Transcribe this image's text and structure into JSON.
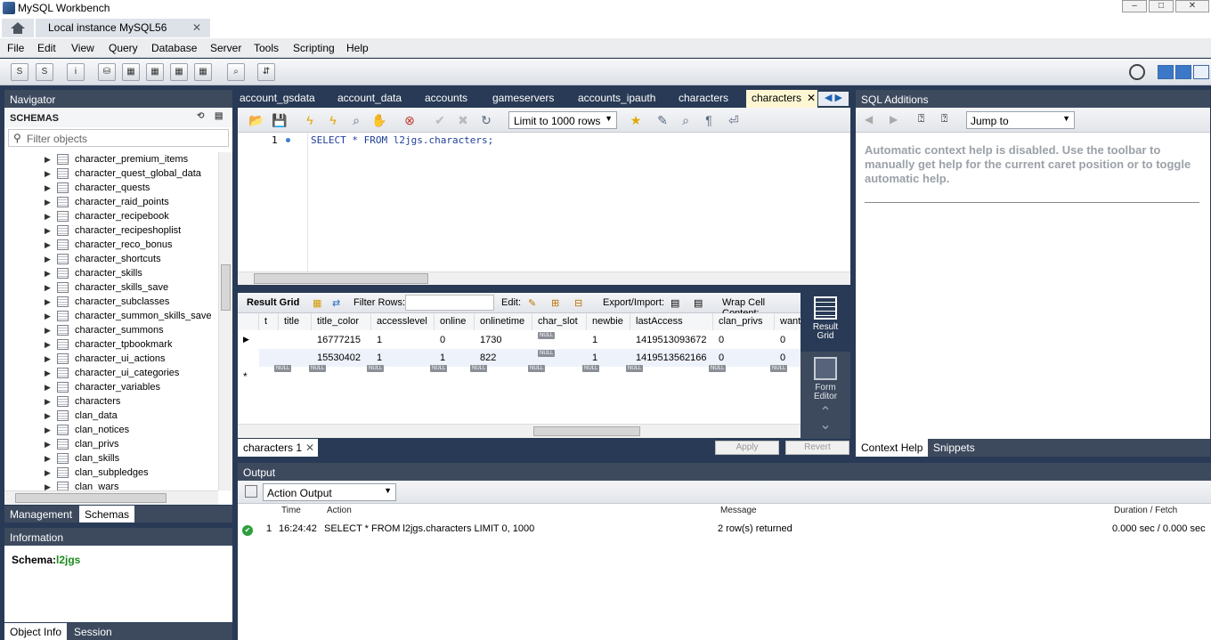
{
  "window": {
    "title": "MySQL Workbench",
    "instance_tab": "Local instance MySQL56",
    "close": "✕"
  },
  "menu": [
    "File",
    "Edit",
    "View",
    "Query",
    "Database",
    "Server",
    "Tools",
    "Scripting",
    "Help"
  ],
  "navigator": {
    "header": "Navigator",
    "schemas_label": "SCHEMAS",
    "filter_placeholder": "Filter objects",
    "items": [
      "character_premium_items",
      "character_quest_global_data",
      "character_quests",
      "character_raid_points",
      "character_recipebook",
      "character_recipeshoplist",
      "character_reco_bonus",
      "character_shortcuts",
      "character_skills",
      "character_skills_save",
      "character_subclasses",
      "character_summon_skills_save",
      "character_summons",
      "character_tpbookmark",
      "character_ui_actions",
      "character_ui_categories",
      "character_variables",
      "characters",
      "clan_data",
      "clan_notices",
      "clan_privs",
      "clan_skills",
      "clan_subpledges",
      "clan_wars"
    ],
    "tabs": [
      "Management",
      "Schemas"
    ]
  },
  "information": {
    "header": "Information",
    "schema_label": "Schema:",
    "schema_value": "l2jgs",
    "tabs": [
      "Object Info",
      "Session"
    ]
  },
  "query_tabs": [
    "account_gsdata",
    "account_data",
    "accounts",
    "gameservers",
    "accounts_ipauth",
    "characters",
    "characters"
  ],
  "query_toolbar": {
    "limit": "Limit to 1000 rows"
  },
  "editor": {
    "line_number": "1",
    "sql": "SELECT * FROM l2jgs.characters;"
  },
  "result_toolbar": {
    "result_grid": "Result Grid",
    "filter_rows": "Filter Rows:",
    "edit": "Edit:",
    "export_import": "Export/Import:",
    "wrap": "Wrap Cell Content:"
  },
  "grid": {
    "columns": [
      "t",
      "title",
      "title_color",
      "accesslevel",
      "online",
      "onlinetime",
      "char_slot",
      "newbie",
      "lastAccess",
      "clan_privs",
      "wants"
    ],
    "rows": [
      [
        "",
        "",
        "16777215",
        "1",
        "0",
        "1730",
        "NULL",
        "1",
        "1419513093672",
        "0",
        "0"
      ],
      [
        "",
        "",
        "15530402",
        "1",
        "1",
        "822",
        "NULL",
        "1",
        "1419513562166",
        "0",
        "0"
      ]
    ],
    "new_row_marker": "*",
    "null_label": "NULL"
  },
  "side_tabs": {
    "result_grid": "Result Grid",
    "form_editor": "Form Editor"
  },
  "result_tab": "characters 1",
  "buttons": {
    "apply": "Apply",
    "revert": "Revert"
  },
  "sql_additions": {
    "header": "SQL Additions",
    "jump_to": "Jump to",
    "help_text": "Automatic context help is disabled. Use the toolbar to manually get help for the current caret position or to toggle automatic help.",
    "tabs": [
      "Context Help",
      "Snippets"
    ]
  },
  "output": {
    "header": "Output",
    "selector": "Action Output",
    "columns": [
      "Time",
      "Action",
      "Message",
      "Duration / Fetch"
    ],
    "row": {
      "index": "1",
      "time": "16:24:42",
      "action": "SELECT * FROM l2jgs.characters LIMIT 0, 1000",
      "message": "2 row(s) returned",
      "duration": "0.000 sec / 0.000 sec"
    }
  }
}
